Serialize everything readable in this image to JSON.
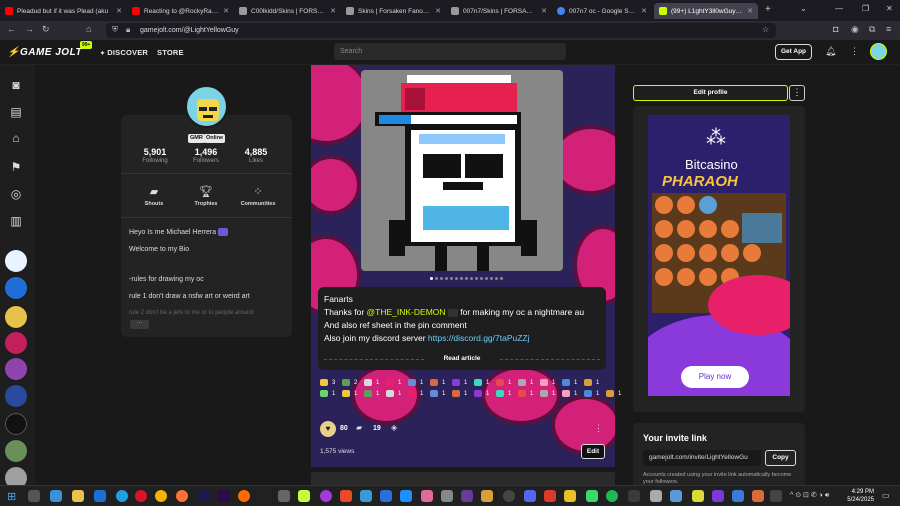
{
  "browser": {
    "tabs": [
      {
        "title": "Pleadud but if it was Plead (aku",
        "color": "#ff0000",
        "active": false
      },
      {
        "title": "Reacting to @RockyRakoon",
        "color": "#ff0000",
        "active": false
      },
      {
        "title": "C00lkidd/Skins | FORSAKEN Wiki",
        "color": "#999999",
        "active": false
      },
      {
        "title": "Skins | Forsaken Fanon Wiki | Fa",
        "color": "#999999",
        "active": false
      },
      {
        "title": "007n7/Skins | FORSAKEN Wiki | F",
        "color": "#999999",
        "active": false
      },
      {
        "title": "007n7 oc - Google Search",
        "color": "#4285f4",
        "active": false
      },
      {
        "title": "(99+) L1ghtY3ll0wGuy (@Light",
        "color": "#ccff00",
        "active": true
      }
    ],
    "url": "gamejolt.com/@LightYellowGuy"
  },
  "header": {
    "logo": "GAME JOLT",
    "badge": "99+",
    "nav": [
      "DISCOVER",
      "STORE"
    ],
    "search_placeholder": "Search",
    "get_app": "Get App"
  },
  "profile": {
    "pills": [
      "GMR",
      "Online"
    ],
    "stats": [
      {
        "value": "5,901",
        "label": "Following"
      },
      {
        "value": "1,496",
        "label": "Followers"
      },
      {
        "value": "4,885",
        "label": "Likes"
      }
    ],
    "quick": [
      "Shouts",
      "Trophies",
      "Communities"
    ],
    "bio": [
      "Heyo Is me Michael Herrera",
      "Welcome to my Bio",
      "-rules for drawing my oc",
      "rule 1 don't draw a nsfw art or weird art",
      "rule 2 don't be a jerk to me or to people around"
    ],
    "more_label": "···"
  },
  "post": {
    "caption_title": "Fanarts",
    "line1_pre": "Thanks for ",
    "line1_mention": "@THE_INK-DEMON",
    "line1_post": " for making my oc a nightmare au",
    "line2": "And also ref sheet in the pin comment",
    "line3_pre": "Also join my discord server ",
    "line3_link": "https://discord.gg/7taPuZZj",
    "read_article": "Read article",
    "stickers": [
      "3",
      "2",
      "1",
      "1",
      "1",
      "1",
      "1",
      "1",
      "1",
      "1",
      "1",
      "1",
      "1",
      "1",
      "1",
      "1",
      "1",
      "1",
      "1",
      "1",
      "1",
      "1",
      "1",
      "1",
      "1",
      "1",
      "1"
    ],
    "likes": "80",
    "comments": "19",
    "views": "1,575 views",
    "edit": "Edit"
  },
  "sidebar": {
    "edit_profile": "Edit profile",
    "ad": {
      "brand": "Bitcasino",
      "game": "PHARAOH",
      "cta": "Play now"
    },
    "invite": {
      "title": "Your invite link",
      "link": "gamejolt.com/invite/LightYellowGu",
      "copy": "Copy",
      "note": "Accounts created using your invite link automatically become your followers."
    }
  },
  "taskbar": {
    "time": "4:29 PM",
    "date": "5/24/2025"
  }
}
